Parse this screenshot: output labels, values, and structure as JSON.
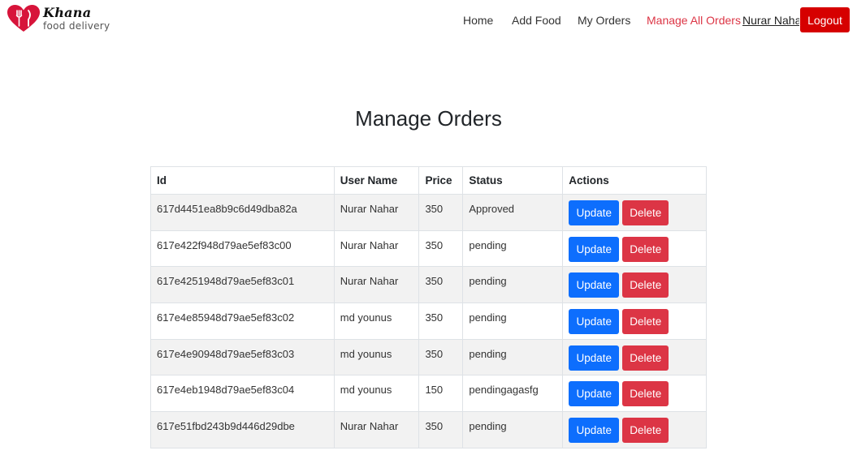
{
  "brand": {
    "name": "Khana",
    "tagline": "food delivery"
  },
  "nav": {
    "home": "Home",
    "add_food": "Add Food",
    "my_orders": "My Orders",
    "manage_all_orders": "Manage All Orders",
    "user": "Nurar Nahar",
    "logout": "Logout"
  },
  "colors": {
    "accent": "#dc3545",
    "primary": "#0d6efd",
    "logout": "#d60000"
  },
  "page": {
    "title": "Manage Orders"
  },
  "table": {
    "headers": {
      "id": "Id",
      "user": "User Name",
      "price": "Price",
      "status": "Status",
      "actions": "Actions"
    },
    "update_label": "Update",
    "delete_label": "Delete",
    "rows": [
      {
        "id": "617d4451ea8b9c6d49dba82a",
        "user": "Nurar Nahar",
        "price": "350",
        "status": "Approved"
      },
      {
        "id": "617e422f948d79ae5ef83c00",
        "user": "Nurar Nahar",
        "price": "350",
        "status": "pending"
      },
      {
        "id": "617e4251948d79ae5ef83c01",
        "user": "Nurar Nahar",
        "price": "350",
        "status": "pending"
      },
      {
        "id": "617e4e85948d79ae5ef83c02",
        "user": "md younus",
        "price": "350",
        "status": "pending"
      },
      {
        "id": "617e4e90948d79ae5ef83c03",
        "user": "md younus",
        "price": "350",
        "status": "pending"
      },
      {
        "id": "617e4eb1948d79ae5ef83c04",
        "user": "md younus",
        "price": "150",
        "status": "pendingagasfg"
      },
      {
        "id": "617e51fbd243b9d446d29dbe",
        "user": "Nurar Nahar",
        "price": "350",
        "status": "pending"
      }
    ]
  }
}
